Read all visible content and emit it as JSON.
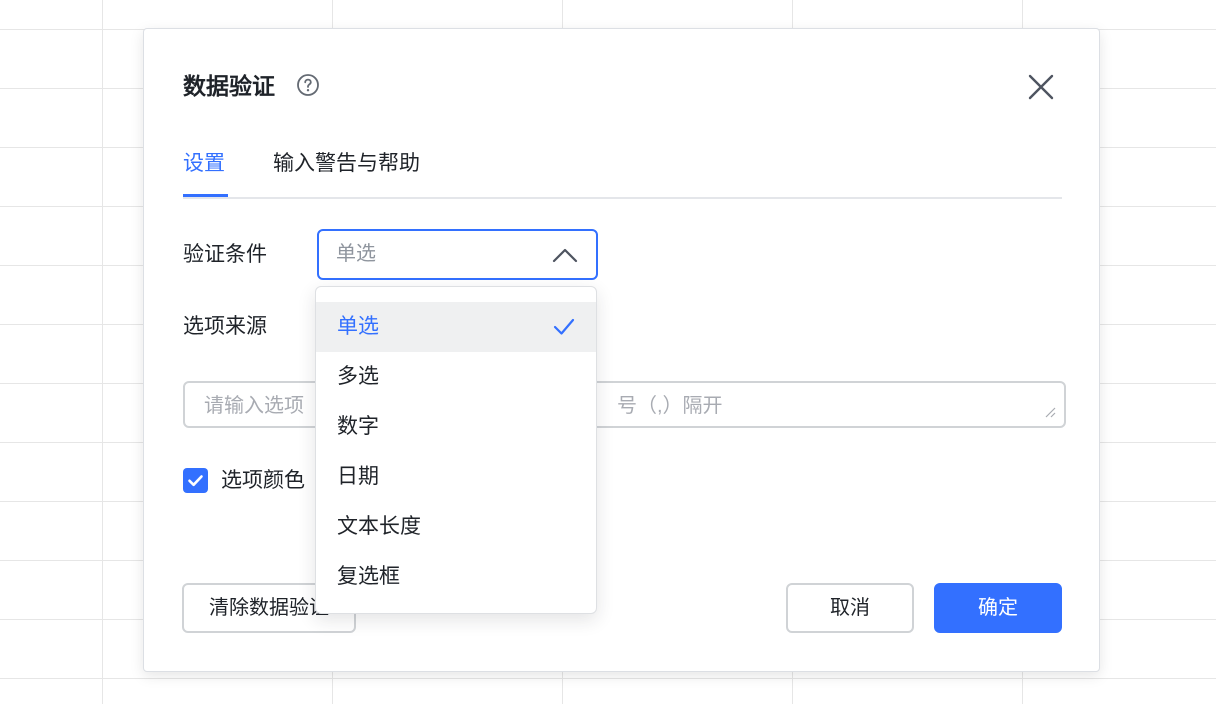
{
  "dialog": {
    "title": "数据验证",
    "tabs": [
      {
        "label": "设置",
        "active": true
      },
      {
        "label": "输入警告与帮助",
        "active": false
      }
    ],
    "fields": {
      "condition_label": "验证条件",
      "condition_value": "单选",
      "source_label": "选项来源",
      "source_placeholder_visible_left": "请输入选项",
      "source_placeholder_visible_right": "号（,）隔开",
      "color_label": "选项颜色",
      "color_checked": true
    },
    "dropdown": {
      "options": [
        {
          "label": "单选",
          "selected": true
        },
        {
          "label": "多选",
          "selected": false
        },
        {
          "label": "数字",
          "selected": false
        },
        {
          "label": "日期",
          "selected": false
        },
        {
          "label": "文本长度",
          "selected": false
        },
        {
          "label": "复选框",
          "selected": false
        }
      ]
    },
    "buttons": {
      "clear_label": "清除数据验证",
      "cancel_label": "取消",
      "ok_label": "确定"
    }
  },
  "colors": {
    "accent": "#3370ff",
    "text": "#1f2329",
    "placeholder": "#8f959e",
    "border": "#d0d3d6",
    "grid": "#e6e6e6"
  },
  "icons": [
    "help-icon",
    "close-icon",
    "chevron-up-icon",
    "check-icon",
    "checkbox-check-icon",
    "resize-grip-icon"
  ]
}
